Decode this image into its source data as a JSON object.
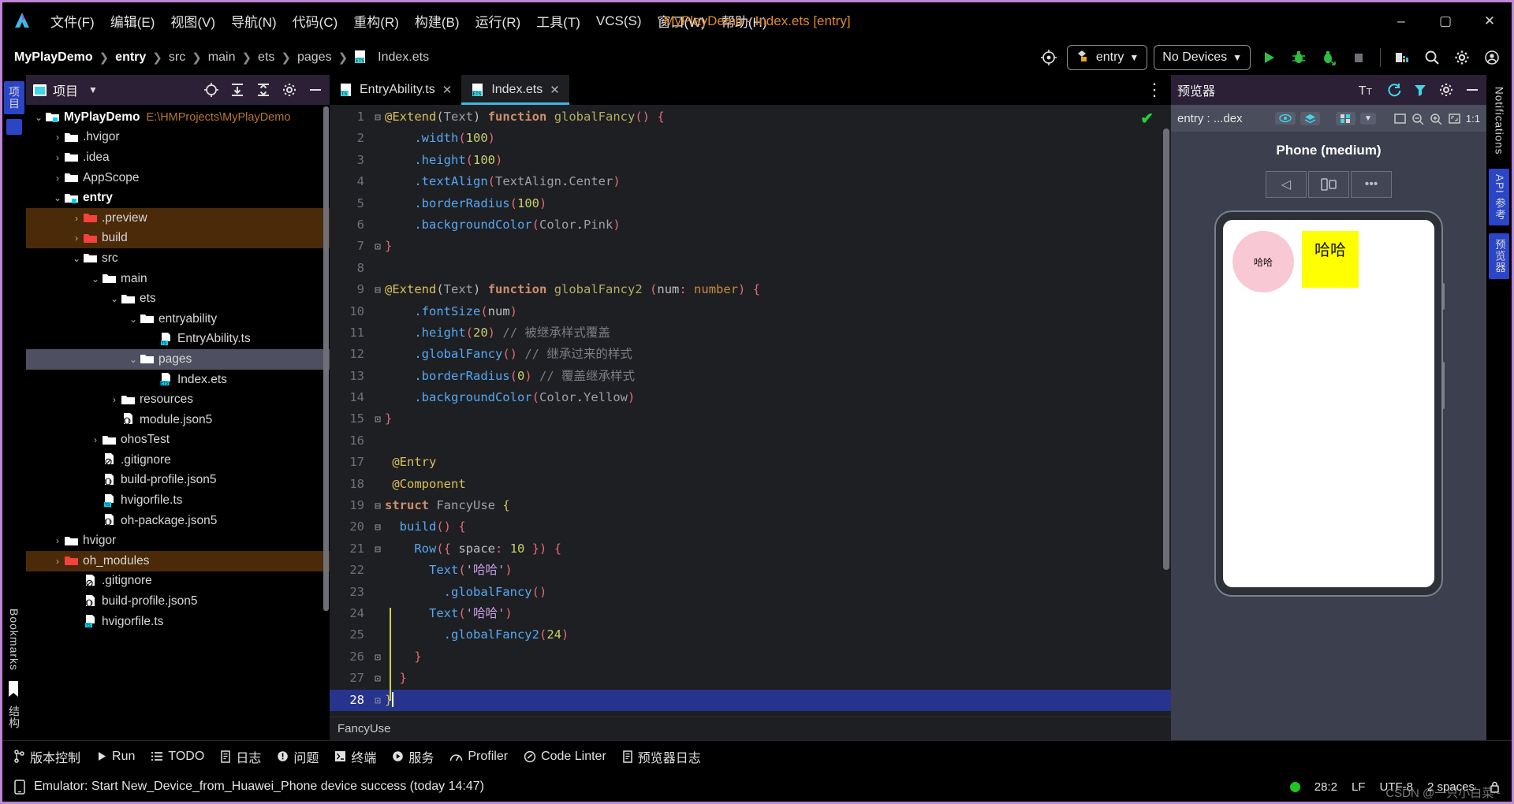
{
  "titlebar": {
    "menus": [
      "文件(F)",
      "编辑(E)",
      "视图(V)",
      "导航(N)",
      "代码(C)",
      "重构(R)",
      "构建(B)",
      "运行(R)",
      "工具(T)",
      "VCS(S)",
      "窗口(W)",
      "帮助(H)"
    ],
    "window_title": "MyPlayDemo - Index.ets [entry]",
    "minimize": "–",
    "maximize": "▢",
    "close": "✕"
  },
  "navbar": {
    "breadcrumbs": [
      "MyPlayDemo",
      "entry",
      "src",
      "main",
      "ets",
      "pages",
      "Index.ets"
    ],
    "separator": "❯",
    "run_config": "entry",
    "device_select": "No Devices",
    "dropdown_caret": "▼",
    "icons": [
      "target-icon",
      "run-icon",
      "debug-icon",
      "profile-run-icon",
      "stop-icon",
      "device-manager-icon",
      "search-icon",
      "settings-gear-icon",
      "account-icon"
    ]
  },
  "left_strip": {
    "tabs": [
      "项目",
      "结构"
    ],
    "bookmarks": "Bookmarks"
  },
  "project_panel": {
    "title": "项目",
    "caret": "▼",
    "head_icons": [
      "locate-file-icon",
      "expand-all-icon",
      "collapse-all-icon",
      "settings-gear-icon",
      "hide-panel-icon"
    ],
    "tree": [
      {
        "label": "MyPlayDemo",
        "path": "E:\\HMProjects\\MyPlayDemo",
        "depth": 0,
        "chev": "v",
        "icon": "module-folder-icon",
        "bold": true,
        "state": "normal"
      },
      {
        "label": ".hvigor",
        "depth": 1,
        "chev": ">",
        "icon": "folder-icon",
        "state": "normal"
      },
      {
        "label": ".idea",
        "depth": 1,
        "chev": ">",
        "icon": "folder-icon",
        "state": "normal"
      },
      {
        "label": "AppScope",
        "depth": 1,
        "chev": ">",
        "icon": "folder-icon",
        "state": "normal"
      },
      {
        "label": "entry",
        "depth": 1,
        "chev": "v",
        "icon": "module-folder-icon",
        "bold": true,
        "state": "normal"
      },
      {
        "label": ".preview",
        "depth": 2,
        "chev": ">",
        "icon": "folder-red-icon",
        "state": "excluded"
      },
      {
        "label": "build",
        "depth": 2,
        "chev": ">",
        "icon": "folder-red-icon",
        "state": "excluded"
      },
      {
        "label": "src",
        "depth": 2,
        "chev": "v",
        "icon": "folder-icon",
        "state": "normal"
      },
      {
        "label": "main",
        "depth": 3,
        "chev": "v",
        "icon": "folder-icon",
        "state": "normal"
      },
      {
        "label": "ets",
        "depth": 4,
        "chev": "v",
        "icon": "folder-icon",
        "state": "normal"
      },
      {
        "label": "entryability",
        "depth": 5,
        "chev": "v",
        "icon": "folder-icon",
        "state": "normal"
      },
      {
        "label": "EntryAbility.ts",
        "depth": 6,
        "chev": "",
        "icon": "ts-file-icon",
        "state": "normal"
      },
      {
        "label": "pages",
        "depth": 5,
        "chev": "v",
        "icon": "folder-icon",
        "state": "selected"
      },
      {
        "label": "Index.ets",
        "depth": 6,
        "chev": "",
        "icon": "ets-file-icon",
        "state": "normal"
      },
      {
        "label": "resources",
        "depth": 4,
        "chev": ">",
        "icon": "folder-icon",
        "state": "normal"
      },
      {
        "label": "module.json5",
        "depth": 4,
        "chev": "",
        "icon": "json5-file-icon",
        "state": "normal"
      },
      {
        "label": "ohosTest",
        "depth": 3,
        "chev": ">",
        "icon": "folder-icon",
        "state": "normal"
      },
      {
        "label": ".gitignore",
        "depth": 3,
        "chev": "",
        "icon": "gitignore-file-icon",
        "state": "normal"
      },
      {
        "label": "build-profile.json5",
        "depth": 3,
        "chev": "",
        "icon": "json5-file-icon",
        "state": "normal"
      },
      {
        "label": "hvigorfile.ts",
        "depth": 3,
        "chev": "",
        "icon": "ts-file-icon",
        "state": "normal"
      },
      {
        "label": "oh-package.json5",
        "depth": 3,
        "chev": "",
        "icon": "json5-file-icon",
        "state": "normal"
      },
      {
        "label": "hvigor",
        "depth": 1,
        "chev": ">",
        "icon": "folder-icon",
        "state": "normal"
      },
      {
        "label": "oh_modules",
        "depth": 1,
        "chev": ">",
        "icon": "folder-red-icon",
        "state": "excluded"
      },
      {
        "label": ".gitignore",
        "depth": 2,
        "chev": "",
        "icon": "gitignore-file-icon",
        "state": "normal"
      },
      {
        "label": "build-profile.json5",
        "depth": 2,
        "chev": "",
        "icon": "json5-file-icon",
        "state": "normal"
      },
      {
        "label": "hvigorfile.ts",
        "depth": 2,
        "chev": "",
        "icon": "ts-file-icon",
        "state": "normal"
      }
    ]
  },
  "editor": {
    "tabs": [
      {
        "label": "EntryAbility.ts",
        "icon": "ts-file-icon",
        "active": false,
        "close": "✕"
      },
      {
        "label": "Index.ets",
        "icon": "ets-file-icon",
        "active": true,
        "close": "✕"
      }
    ],
    "more_icon": "⋮",
    "inspection_ok": "✔",
    "bottom_breadcrumb": "FancyUse",
    "code_lines": [
      {
        "n": 1,
        "fold": "⊟",
        "html": "<span class=\"anno\">@Extend</span><span class=\"pun\">(</span><span class=\"grey\">Text</span><span class=\"pun\">)</span> <span class=\"kw\">function</span> <span class=\"fn2\">globalFancy</span><span class=\"pun2\">()</span> <span class=\"pun2\">{</span>"
      },
      {
        "n": 2,
        "fold": "",
        "html": "    <span class=\"meth\">.width</span><span class=\"pun2\">(</span><span class=\"num\">100</span><span class=\"pun2\">)</span>"
      },
      {
        "n": 3,
        "fold": "",
        "html": "    <span class=\"meth\">.height</span><span class=\"pun2\">(</span><span class=\"num\">100</span><span class=\"pun2\">)</span>"
      },
      {
        "n": 4,
        "fold": "",
        "html": "    <span class=\"meth\">.textAlign</span><span class=\"pun2\">(</span><span class=\"grey\">TextAlign</span><span class=\"pun\">.</span><span class=\"grey\">Center</span><span class=\"pun2\">)</span>"
      },
      {
        "n": 5,
        "fold": "",
        "html": "    <span class=\"meth\">.borderRadius</span><span class=\"pun2\">(</span><span class=\"num\">100</span><span class=\"pun2\">)</span>"
      },
      {
        "n": 6,
        "fold": "",
        "html": "    <span class=\"meth\">.backgroundColor</span><span class=\"pun2\">(</span><span class=\"grey\">Color</span><span class=\"pun\">.</span><span class=\"grey\">Pink</span><span class=\"pun2\">)</span>"
      },
      {
        "n": 7,
        "fold": "⊡",
        "html": "<span class=\"pun2\">}</span>"
      },
      {
        "n": 8,
        "fold": "",
        "html": ""
      },
      {
        "n": 9,
        "fold": "⊟",
        "html": "<span class=\"anno\">@Extend</span><span class=\"pun\">(</span><span class=\"grey\">Text</span><span class=\"pun\">)</span> <span class=\"kw\">function</span> <span class=\"fn2\">globalFancy2</span> <span class=\"pun2\">(</span><span class=\"pun\">num</span><span class=\"pun2\">:</span> <span class=\"param\">number</span><span class=\"pun2\">)</span> <span class=\"pun2\">{</span>"
      },
      {
        "n": 10,
        "fold": "",
        "html": "    <span class=\"meth\">.fontSize</span><span class=\"pun2\">(</span><span class=\"pun\">num</span><span class=\"pun2\">)</span>"
      },
      {
        "n": 11,
        "fold": "",
        "html": "    <span class=\"meth\">.height</span><span class=\"pun2\">(</span><span class=\"num\">20</span><span class=\"pun2\">)</span> <span class=\"cmt\">// 被继承样式覆盖</span>"
      },
      {
        "n": 12,
        "fold": "",
        "html": "    <span class=\"meth\">.globalFancy</span><span class=\"pun2\">()</span> <span class=\"cmt\">// 继承过来的样式</span>"
      },
      {
        "n": 13,
        "fold": "",
        "html": "    <span class=\"meth\">.borderRadius</span><span class=\"pun2\">(</span><span class=\"num\">0</span><span class=\"pun2\">)</span> <span class=\"cmt\">// 覆盖继承样式</span>"
      },
      {
        "n": 14,
        "fold": "",
        "html": "    <span class=\"meth\">.backgroundColor</span><span class=\"pun2\">(</span><span class=\"grey\">Color</span><span class=\"pun\">.</span><span class=\"grey\">Yellow</span><span class=\"pun2\">)</span>"
      },
      {
        "n": 15,
        "fold": "⊡",
        "html": "<span class=\"pun2\">}</span>"
      },
      {
        "n": 16,
        "fold": "",
        "html": ""
      },
      {
        "n": 17,
        "fold": "",
        "html": " <span class=\"anno\">@Entry</span>"
      },
      {
        "n": 18,
        "fold": "",
        "html": " <span class=\"anno\">@Component</span>"
      },
      {
        "n": 19,
        "fold": "⊟",
        "html": "<span class=\"kw\">struct</span> <span class=\"grey\">FancyUse</span> <span class=\"anno\">{</span>"
      },
      {
        "n": 20,
        "fold": "⊟",
        "html": "  <span class=\"meth\">build</span><span class=\"pun2\">()</span> <span class=\"pun2\">{</span>"
      },
      {
        "n": 21,
        "fold": "⊟",
        "html": "    <span class=\"meth\">Row</span><span class=\"pun2\">({</span> <span class=\"pun\">space</span><span class=\"pun2\">:</span> <span class=\"num\">10</span> <span class=\"pun2\">})</span> <span class=\"pun2\">{</span>"
      },
      {
        "n": 22,
        "fold": "",
        "html": "      <span class=\"meth\">Text</span><span class=\"pun2\">(</span><span class=\"str\">'哈哈'</span><span class=\"pun2\">)</span>"
      },
      {
        "n": 23,
        "fold": "",
        "html": "        <span class=\"meth\">.globalFancy</span><span class=\"pun2\">()</span>"
      },
      {
        "n": 24,
        "fold": "",
        "html": "      <span class=\"meth\">Text</span><span class=\"pun2\">(</span><span class=\"str\">'哈哈'</span><span class=\"pun2\">)</span>"
      },
      {
        "n": 25,
        "fold": "",
        "html": "        <span class=\"meth\">.globalFancy2</span><span class=\"pun2\">(</span><span class=\"num\">24</span><span class=\"pun2\">)</span>"
      },
      {
        "n": 26,
        "fold": "⊡",
        "html": "    <span class=\"pun2\">}</span>"
      },
      {
        "n": 27,
        "fold": "⊡",
        "html": "  <span class=\"pun2\">}</span>"
      },
      {
        "n": 28,
        "fold": "⊡",
        "html": "<span class=\"anno\">}</span><span class=\"cursor-bar\"></span>",
        "cursor": true
      }
    ]
  },
  "previewer": {
    "title": "预览器",
    "head_icons": [
      "font-size-icon",
      "refresh-icon",
      "inspector-icon",
      "settings-gear-icon",
      "hide-panel-icon"
    ],
    "target": "entry : ...dex",
    "toolbar_icons": [
      "eye-icon",
      "layers-icon",
      "grid-icon",
      "chevron-down-icon",
      "select-icon",
      "zoom-out-icon",
      "zoom-in-icon",
      "fit-icon"
    ],
    "zoom_level": "1:1",
    "device_label": "Phone (medium)",
    "device_controls": [
      "rotate-left-icon",
      "multi-device-icon",
      "more-icon"
    ],
    "rotate_left": "◁",
    "multi_device": "⫴",
    "more": "•••",
    "screen": {
      "text_pink": "哈哈",
      "text_yellow": "哈哈",
      "pink_color": "#f9c8d5",
      "yellow_color": "#ffff00"
    }
  },
  "right_strip": {
    "tabs": [
      "Notifications",
      "API 参考",
      "预览器"
    ]
  },
  "bottom_toolbar": {
    "items": [
      {
        "label": "版本控制",
        "icon": "branch-icon"
      },
      {
        "label": "Run",
        "icon": "run-icon"
      },
      {
        "label": "TODO",
        "icon": "list-icon"
      },
      {
        "label": "日志",
        "icon": "log-icon"
      },
      {
        "label": "问题",
        "icon": "warning-icon"
      },
      {
        "label": "终端",
        "icon": "terminal-icon"
      },
      {
        "label": "服务",
        "icon": "services-icon"
      },
      {
        "label": "Profiler",
        "icon": "profiler-icon"
      },
      {
        "label": "Code Linter",
        "icon": "linter-icon"
      },
      {
        "label": "预览器日志",
        "icon": "log-icon"
      }
    ]
  },
  "statusbar": {
    "message_icon": "device-icon",
    "message": "Emulator: Start New_Device_from_Huawei_Phone device success (today 14:47)",
    "caret_position": "28:2",
    "line_separator": "LF",
    "encoding": "UTF-8",
    "indent": "2 spaces",
    "lock_icon": "lock-icon",
    "watermark": "CSDN @一只小白菜~"
  }
}
